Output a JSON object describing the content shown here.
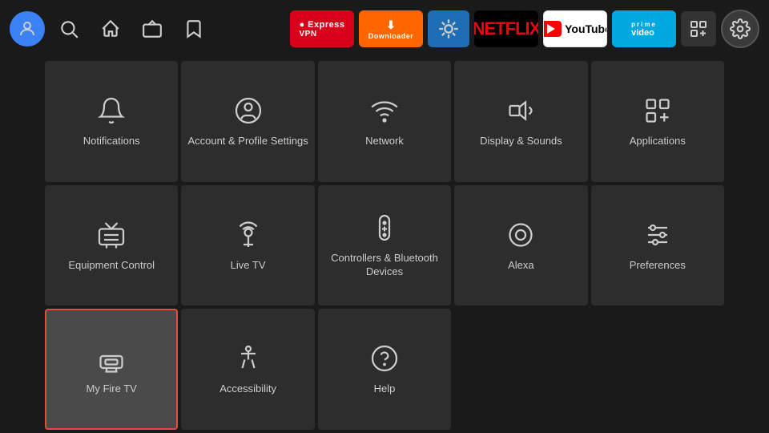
{
  "topbar": {
    "nav_items": [
      {
        "name": "avatar",
        "label": "User Avatar"
      },
      {
        "name": "search",
        "label": "Search"
      },
      {
        "name": "home",
        "label": "Home"
      },
      {
        "name": "live",
        "label": "Live TV"
      },
      {
        "name": "watchlist",
        "label": "Watchlist"
      }
    ],
    "apps": [
      {
        "name": "expressvpn",
        "label": "ExpressVPN"
      },
      {
        "name": "downloader",
        "label": "Downloader"
      },
      {
        "name": "generic-app",
        "label": "App"
      },
      {
        "name": "netflix",
        "label": "NETFLIX"
      },
      {
        "name": "youtube",
        "label": "YouTube"
      },
      {
        "name": "primevideo",
        "label": "prime video"
      },
      {
        "name": "grid-app",
        "label": "App Grid"
      },
      {
        "name": "settings",
        "label": "Settings"
      }
    ]
  },
  "grid": {
    "items": [
      {
        "id": "notifications",
        "label": "Notifications",
        "icon": "bell"
      },
      {
        "id": "account-profile",
        "label": "Account & Profile Settings",
        "icon": "person-circle"
      },
      {
        "id": "network",
        "label": "Network",
        "icon": "wifi"
      },
      {
        "id": "display-sounds",
        "label": "Display & Sounds",
        "icon": "speaker"
      },
      {
        "id": "applications",
        "label": "Applications",
        "icon": "app-grid"
      },
      {
        "id": "equipment-control",
        "label": "Equipment Control",
        "icon": "tv"
      },
      {
        "id": "live-tv",
        "label": "Live TV",
        "icon": "antenna"
      },
      {
        "id": "controllers-bluetooth",
        "label": "Controllers & Bluetooth Devices",
        "icon": "remote"
      },
      {
        "id": "alexa",
        "label": "Alexa",
        "icon": "alexa-ring"
      },
      {
        "id": "preferences",
        "label": "Preferences",
        "icon": "sliders"
      },
      {
        "id": "my-fire-tv",
        "label": "My Fire TV",
        "icon": "firetv",
        "selected": true
      },
      {
        "id": "accessibility",
        "label": "Accessibility",
        "icon": "accessibility"
      },
      {
        "id": "help",
        "label": "Help",
        "icon": "question"
      },
      {
        "id": "empty1",
        "label": "",
        "icon": ""
      },
      {
        "id": "empty2",
        "label": "",
        "icon": ""
      }
    ]
  }
}
